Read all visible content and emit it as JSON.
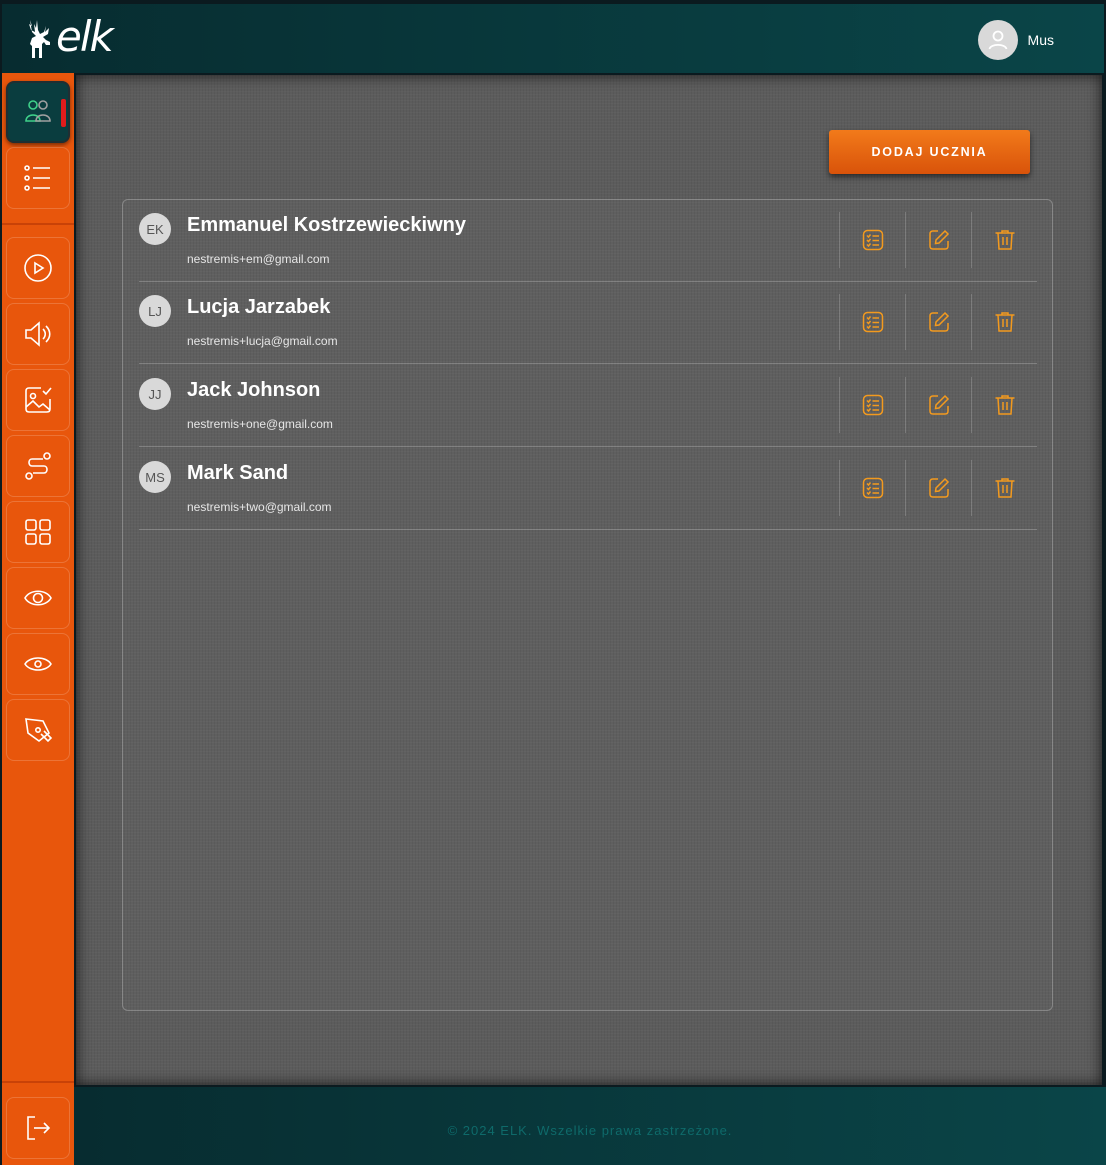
{
  "header": {
    "logo_text": "elk",
    "user_name": "Mus"
  },
  "sidebar": {
    "items": [
      {
        "icon": "users-icon",
        "active": true
      },
      {
        "icon": "list-icon",
        "active": false
      },
      {
        "icon": "play-icon",
        "active": false
      },
      {
        "icon": "speaker-icon",
        "active": false
      },
      {
        "icon": "image-check-icon",
        "active": false
      },
      {
        "icon": "route-icon",
        "active": false
      },
      {
        "icon": "grid-icon",
        "active": false
      },
      {
        "icon": "eye-icon",
        "active": false
      },
      {
        "icon": "eye-small-icon",
        "active": false
      },
      {
        "icon": "pen-tool-icon",
        "active": false
      }
    ],
    "logout_icon": "logout-icon"
  },
  "main": {
    "add_button_label": "DODAJ UCZNIA",
    "students": [
      {
        "initials": "EK",
        "name": "Emmanuel Kostrzewieckiwny",
        "email": "nestremis+em@gmail.com"
      },
      {
        "initials": "LJ",
        "name": "Lucja Jarzabek",
        "email": "nestremis+lucja@gmail.com"
      },
      {
        "initials": "JJ",
        "name": "Jack Johnson",
        "email": "nestremis+one@gmail.com"
      },
      {
        "initials": "MS",
        "name": "Mark Sand",
        "email": "nestremis+two@gmail.com"
      }
    ],
    "row_actions": [
      "checklist-icon",
      "edit-icon",
      "trash-icon"
    ]
  },
  "footer": {
    "copyright": "© 2024 ELK. Wszelkie prawa zastrzeżone."
  },
  "colors": {
    "accent": "#e8560c",
    "header": "#0a4548",
    "icon_orange": "#f39a1e"
  }
}
